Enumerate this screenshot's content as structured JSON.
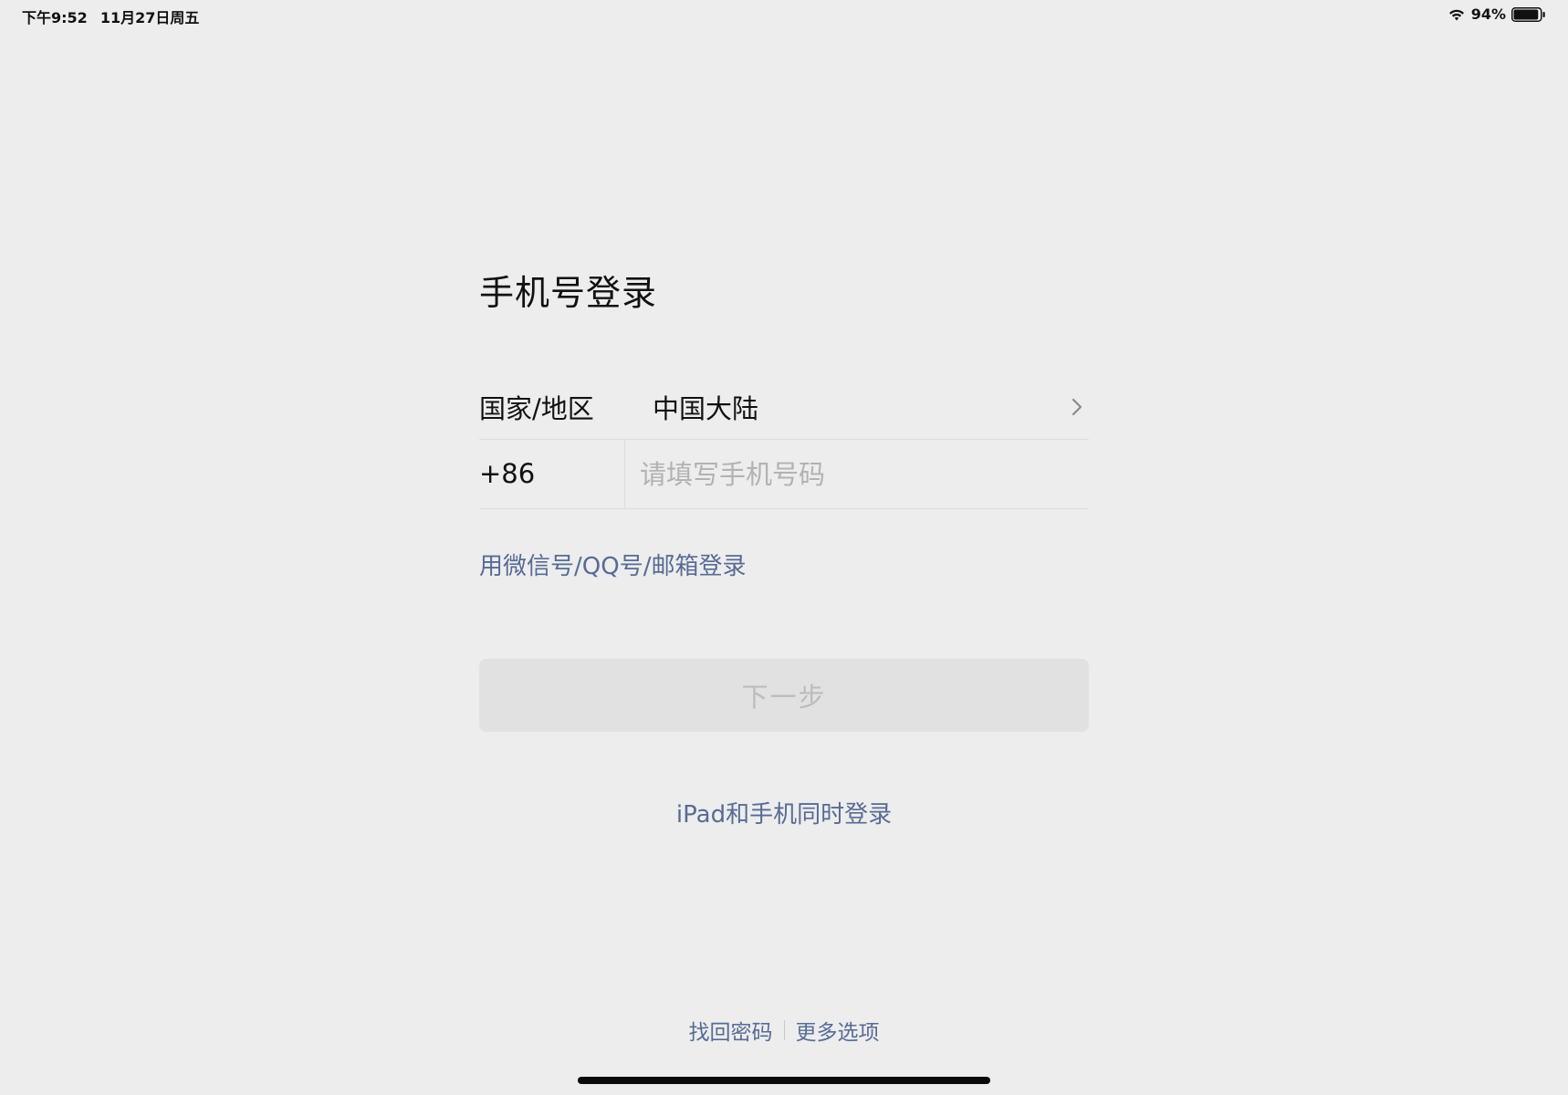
{
  "status_bar": {
    "time": "下午9:52",
    "date": "11月27日周五",
    "battery_percent": "94%",
    "battery_level": 0.94
  },
  "page": {
    "title": "手机号登录"
  },
  "form": {
    "region_label": "国家/地区",
    "region_value": "中国大陆",
    "country_code": "+86",
    "phone_placeholder": "请填写手机号码",
    "phone_value": ""
  },
  "links": {
    "alt_login": "用微信号/QQ号/邮箱登录",
    "dual_login": "iPad和手机同时登录",
    "recover_password": "找回密码",
    "more_options": "更多选项"
  },
  "buttons": {
    "next": "下一步"
  },
  "icons": {
    "wifi": "wifi-icon",
    "battery": "battery-icon",
    "chevron": "chevron-right-icon"
  },
  "colors": {
    "background": "#ededed",
    "link": "#576b95",
    "disabled_button_bg": "#e1e1e1",
    "disabled_button_text": "#bcbcbc"
  }
}
